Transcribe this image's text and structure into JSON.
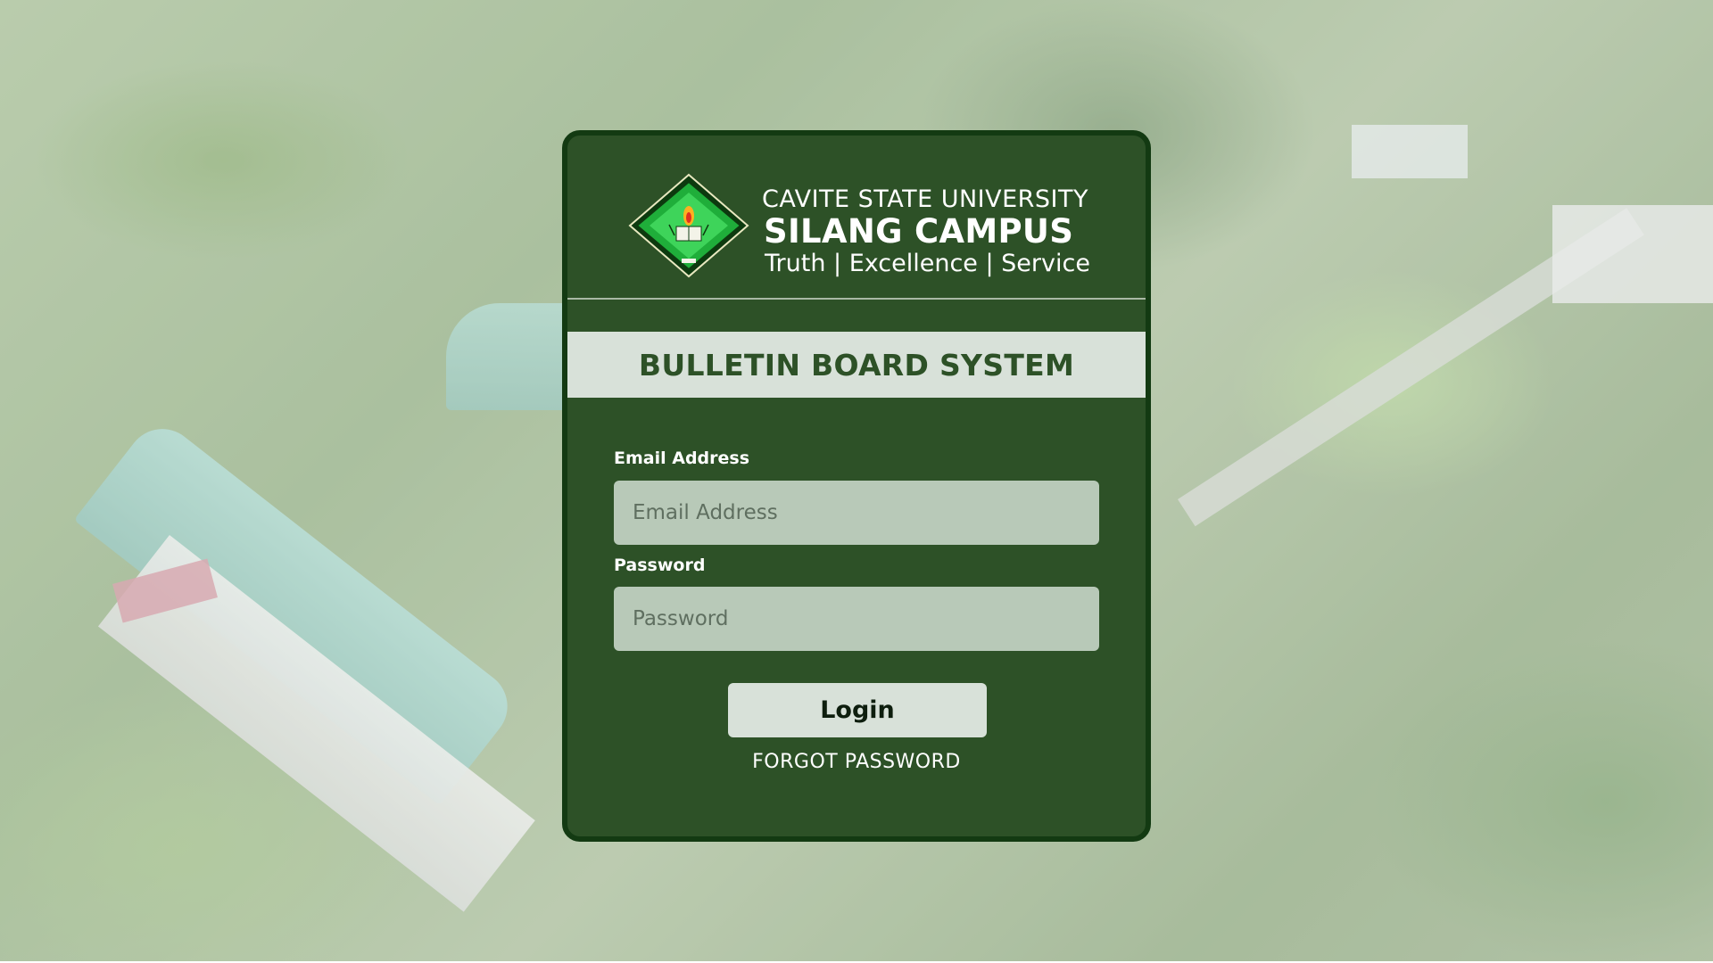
{
  "header": {
    "university": "CAVITE STATE UNIVERSITY",
    "campus": "SILANG CAMPUS",
    "motto": "Truth | Excellence | Service",
    "logo_icon": "university-seal-icon"
  },
  "banner": {
    "title": "BULLETIN BOARD SYSTEM"
  },
  "form": {
    "email_label": "Email Address",
    "email_placeholder": "Email Address",
    "email_value": "",
    "password_label": "Password",
    "password_placeholder": "Password",
    "password_value": "",
    "login_label": "Login",
    "forgot_label": "FORGOT PASSWORD"
  },
  "colors": {
    "card_bg": "#2d5127",
    "card_border": "#133a12",
    "banner_bg": "#d8e1d9",
    "input_bg": "#b8c9b8",
    "seal_green": "#1fae3a"
  }
}
